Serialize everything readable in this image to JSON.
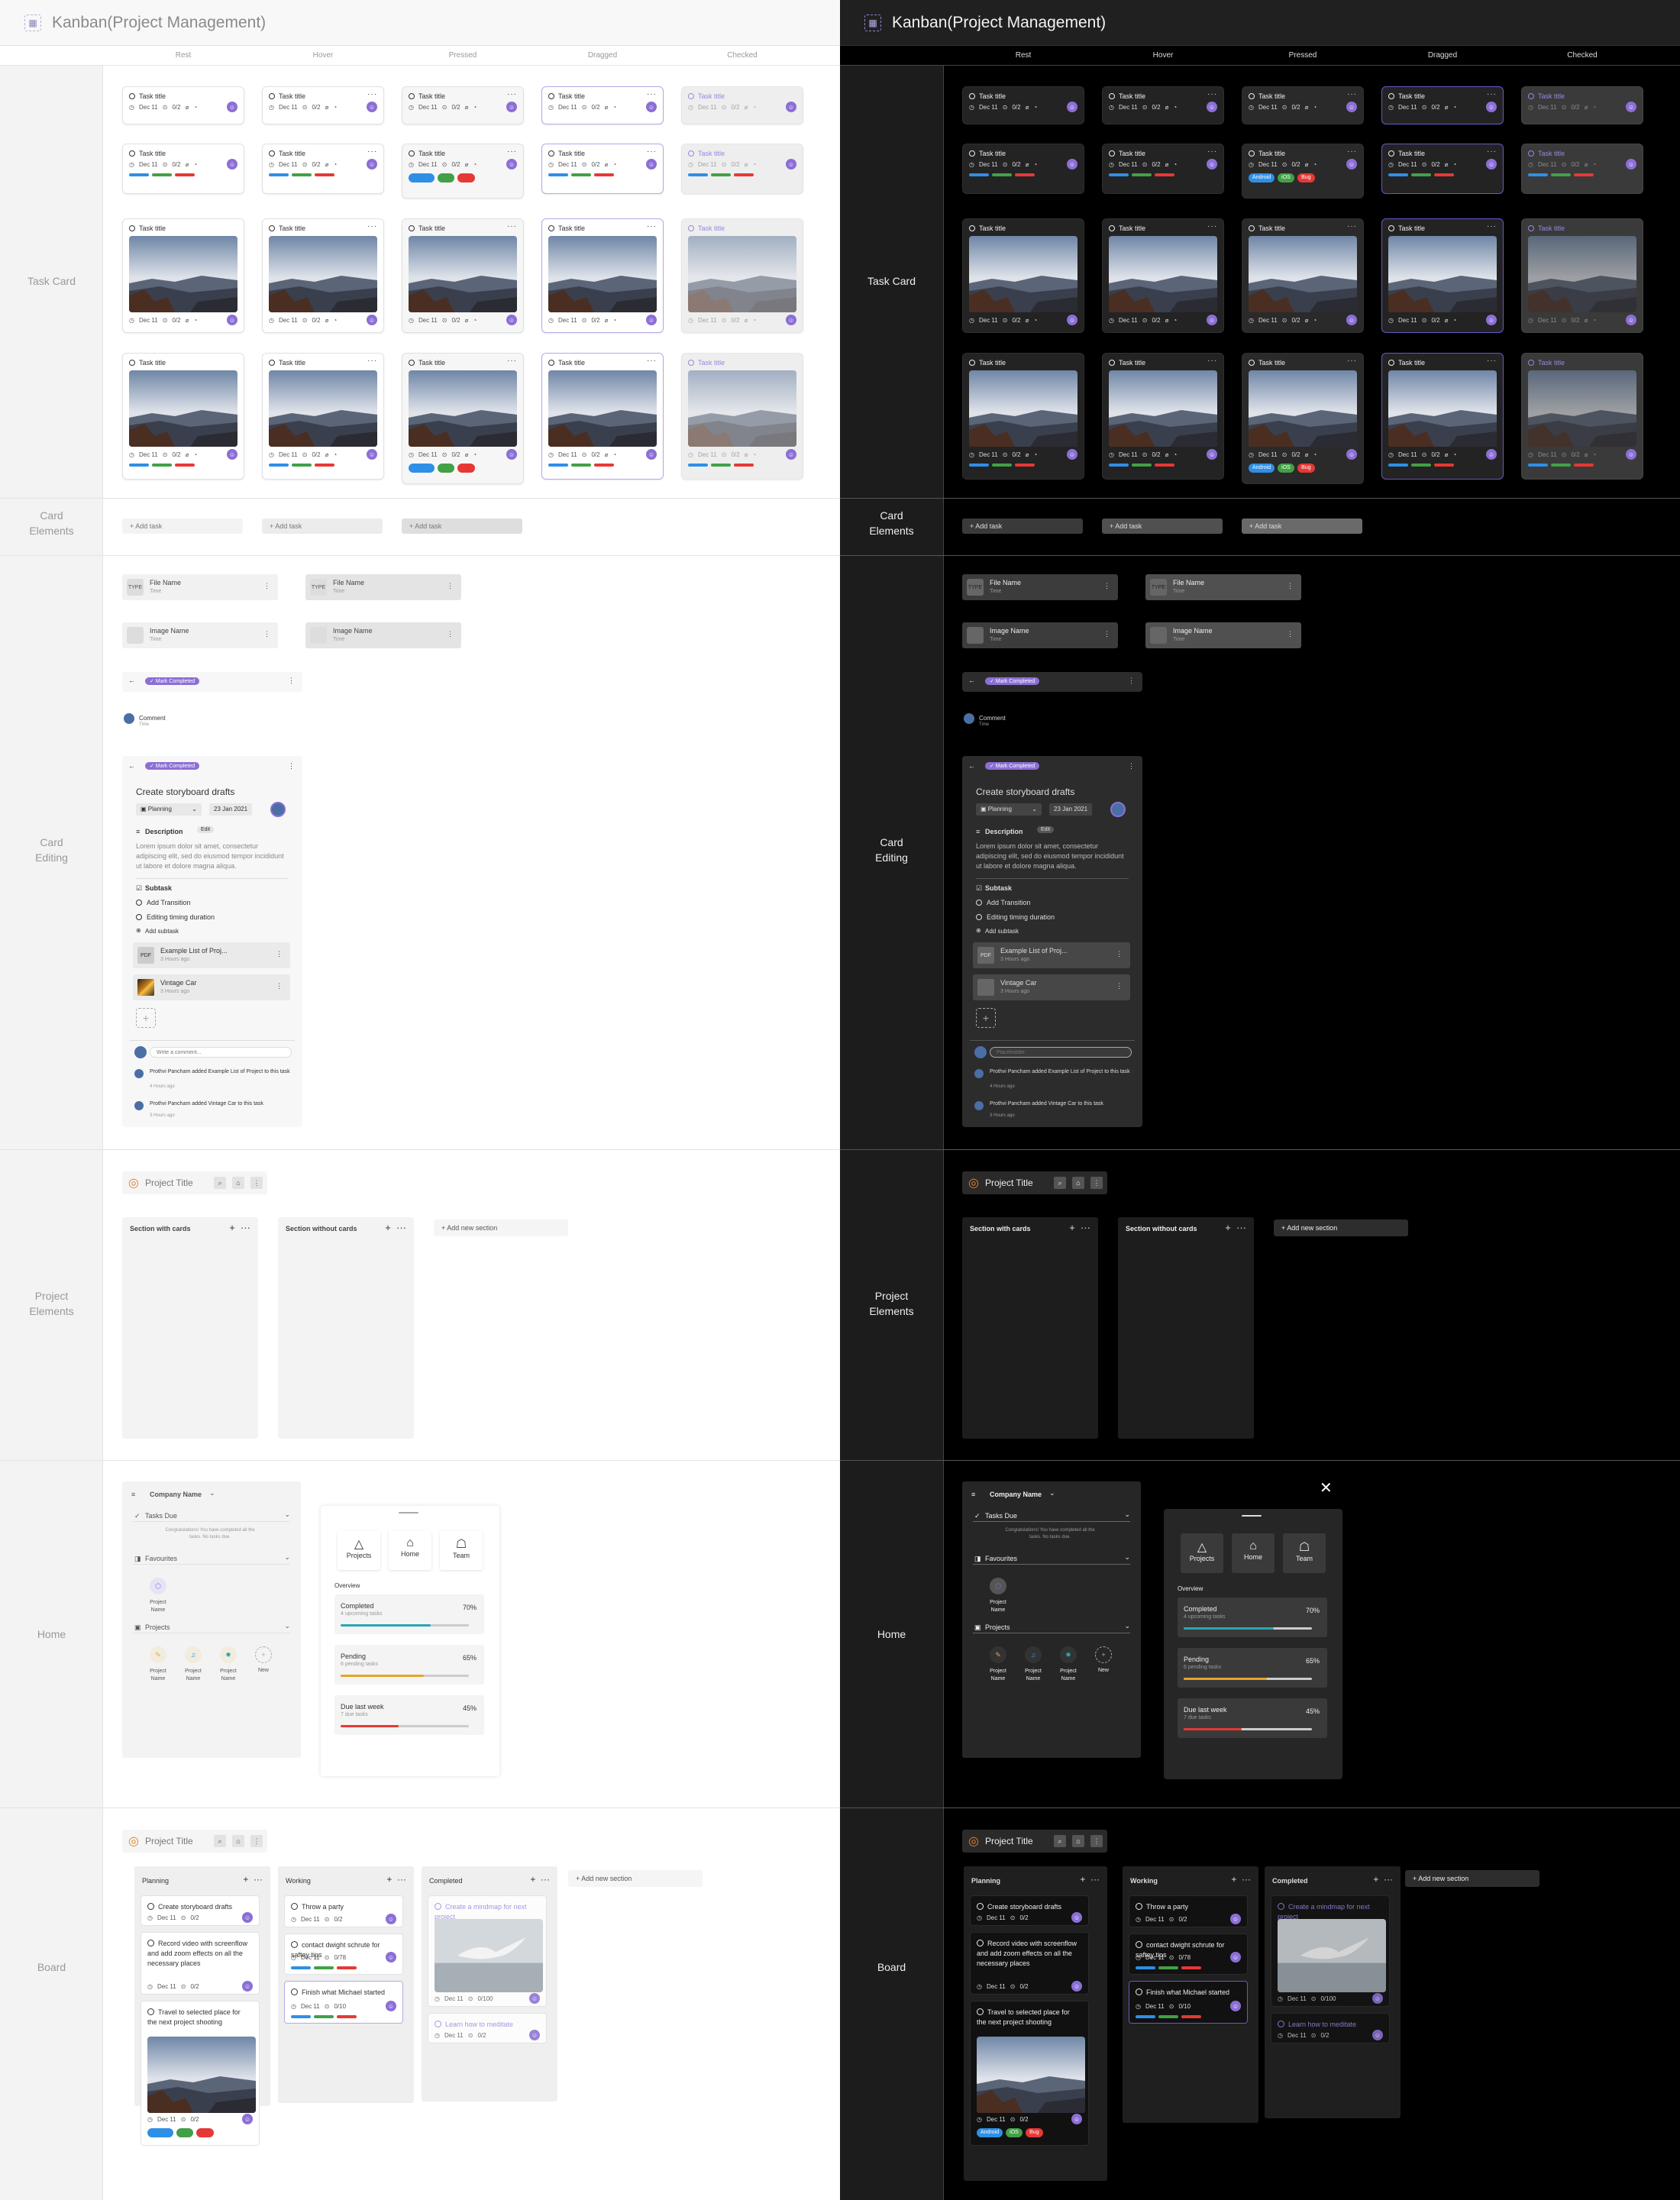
{
  "title": "Kanban(Project Management)",
  "columns": [
    "Rest",
    "Hover",
    "Pressed",
    "Dragged",
    "Checked"
  ],
  "rows": {
    "task_card": "Task Card",
    "card_elements": "Card\nElements",
    "card_editing": "Card\nEditing",
    "project_elements": "Project\nElements",
    "home": "Home",
    "board": "Board"
  },
  "card": {
    "title": "Task title",
    "date": "Dec 11",
    "sub": "0/2",
    "more": "···"
  },
  "chips": [
    "Android",
    "iOS",
    "Bug"
  ],
  "colors": {
    "accent": "#8b6fd6",
    "blue": "#2f8fe6",
    "green": "#43a047",
    "red": "#e53935",
    "teal": "#2aa6b4",
    "orange": "#e5a52a"
  },
  "add_task": "+ Add task",
  "files": {
    "type": "TYPE",
    "file_name": "File Name",
    "image_name": "Image Name",
    "time": "Time"
  },
  "mark_completed": "✓ Mark Completed",
  "comment": {
    "label": "Comment",
    "time": "Time"
  },
  "editing": {
    "title": "Create storyboard drafts",
    "status": "Planning",
    "date": "23 Jan 2021",
    "description_label": "Description",
    "edit": "Edit",
    "description": "Lorem ipsum dolor sit amet, consectetur adipiscing elit, sed do eiusmod tempor incididunt ut labore et dolore magna aliqua.",
    "subtask_label": "Subtask",
    "subtasks": [
      "Add Transition",
      "Editing timing duration"
    ],
    "add_subtask": "Add subtask",
    "attachments": [
      {
        "type": "PDF",
        "name": "Example List of Proj...",
        "time": "3 Hours ago"
      },
      {
        "type": "",
        "name": "Vintage Car",
        "time": "3 Hours ago"
      }
    ],
    "comment_placeholder": "Write a comment...",
    "dark_placeholder": "Placeholder",
    "activity": [
      {
        "text": "Prothvi Pancham added Example List of Project to this task",
        "time": "4 Hours ago"
      },
      {
        "text": "Prothvi Pancham added Vintage Car to this task",
        "time": "3 Hours ago"
      }
    ]
  },
  "project": {
    "title": "Project Title",
    "section_with": "Section with cards",
    "section_without": "Section without cards",
    "add_section": "+ Add new section"
  },
  "home": {
    "company": "Company Name",
    "tasks_due": "Tasks Due",
    "congrats": "Congratulations! You have completed all the tasks. No tasks due.",
    "favourites": "Favourites",
    "projects": "Projects",
    "project_name": "Project Name",
    "new": "New",
    "tabs": [
      "Projects",
      "Home",
      "Team"
    ],
    "overview": "Overview",
    "stats": [
      {
        "name": "Completed",
        "sub": "4 upcoming tasks",
        "pct": "70%",
        "value": 0.7
      },
      {
        "name": "Pending",
        "sub": "6 pending tasks",
        "pct": "65%",
        "value": 0.65
      },
      {
        "name": "Due last week",
        "sub": "7 due tasks",
        "pct": "45%",
        "value": 0.45
      }
    ]
  },
  "board": {
    "columns": [
      {
        "name": "Planning",
        "cards": [
          "Create storyboard drafts",
          "Record video with screenflow and add zoom effects on all the necessary places",
          "Travel to selected place for the next project shooting"
        ]
      },
      {
        "name": "Working",
        "cards": [
          "Throw a party",
          "contact dwight schrute for saftey tips",
          "Finish what Michael started"
        ]
      },
      {
        "name": "Completed",
        "cards": [
          "Create a mindmap for next project",
          "Learn how to meditate"
        ]
      }
    ],
    "meta": [
      "0/2",
      "0/2",
      "0/2",
      "0/2",
      "0/78",
      "0/10",
      "0/100",
      "0/2",
      "0/100"
    ]
  }
}
